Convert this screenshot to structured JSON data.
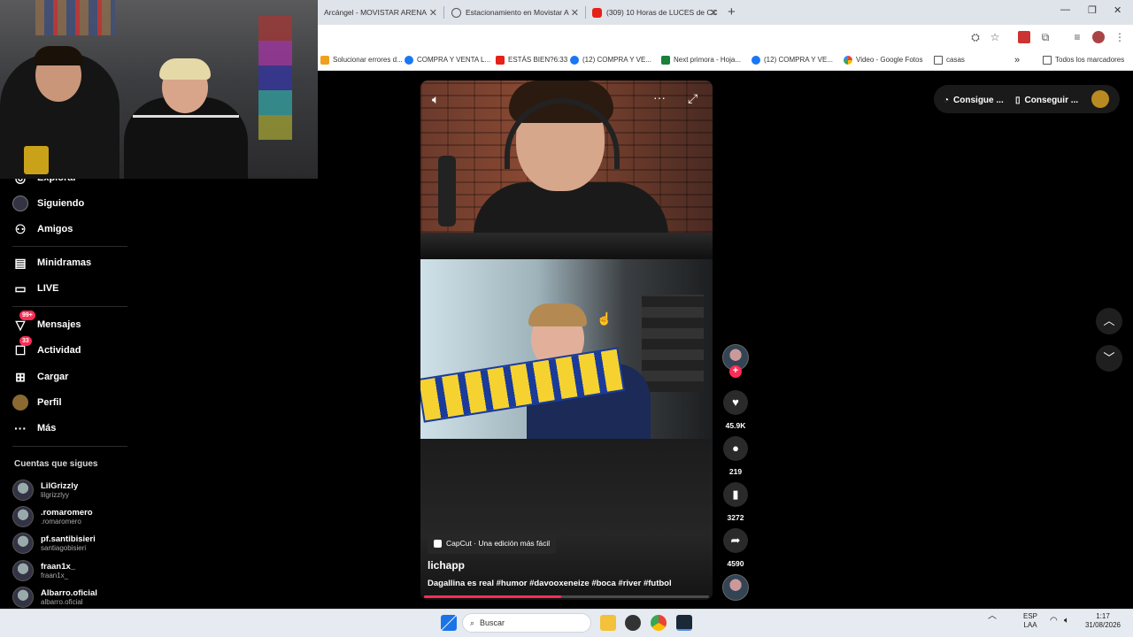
{
  "browser": {
    "tabs": [
      {
        "title": "Arcángel - MOVISTAR ARENA",
        "icon_color": "#dfe3ea"
      },
      {
        "title": "Estacionamiento en Movistar A",
        "icon": "globe-icon"
      },
      {
        "title": "(309) 10 Horas de LUCES de CC",
        "icon": "youtube-icon"
      }
    ],
    "new_tab": "+",
    "window_controls": {
      "minimize": "—",
      "maximize": "❐",
      "close": "✕"
    },
    "bookmarks": [
      {
        "label": "Solucionar errores d...",
        "color": "#f0a020"
      },
      {
        "label": "COMPRA Y VENTA L...",
        "color": "#1877f2"
      },
      {
        "label": "ESTÁS BIEN?6:33",
        "color": "#e62117"
      },
      {
        "label": "(12) COMPRA Y VE...",
        "color": "#1877f2"
      },
      {
        "label": "Next primora - Hoja...",
        "color": "#188038"
      },
      {
        "label": "(12) COMPRA Y VE...",
        "color": "#1877f2"
      },
      {
        "label": "Video - Google Fotos",
        "color": "#fbbc04"
      },
      {
        "label": "casas",
        "color": "#555555"
      }
    ],
    "bookmarks_more": "»",
    "all_bookmarks": "Todos los marcadores"
  },
  "sidebar": {
    "items": [
      {
        "label": "Explorar",
        "icon": "compass-icon"
      },
      {
        "label": "Siguiendo",
        "icon": "following-icon"
      },
      {
        "label": "Amigos",
        "icon": "friends-icon"
      },
      {
        "label": "Minidramas",
        "icon": "minidramas-icon"
      },
      {
        "label": "LIVE",
        "icon": "live-icon"
      },
      {
        "label": "Mensajes",
        "icon": "messages-icon",
        "badge": "99+"
      },
      {
        "label": "Actividad",
        "icon": "activity-icon",
        "badge": "33"
      },
      {
        "label": "Cargar",
        "icon": "upload-icon"
      },
      {
        "label": "Perfil",
        "icon": "profile-icon"
      },
      {
        "label": "Más",
        "icon": "more-icon"
      }
    ],
    "following_title": "Cuentas que sigues",
    "following": [
      {
        "name": "LilGrizzly",
        "handle": "lilgrizzlyy"
      },
      {
        "name": ".romaromero",
        "handle": ".romaromero"
      },
      {
        "name": "pf.santibisieri",
        "handle": "santiagobisieri"
      },
      {
        "name": "fraan1x_",
        "handle": "fraan1x_"
      },
      {
        "name": "Albarro.oficial",
        "handle": "albarro.oficial"
      }
    ]
  },
  "header": {
    "get_coins": "Consigue ...",
    "get_app": "Conseguir ..."
  },
  "video": {
    "capcut_label": "CapCut · Una edición más fácil",
    "author": "lichapp",
    "description": "Dagallina es real #humor #davooxeneize #boca #river #futbol",
    "progress": 0.48,
    "likes": "45.9K",
    "comments": "219",
    "saves": "3272",
    "shares": "4590"
  },
  "taskbar": {
    "search_placeholder": "Buscar",
    "lang_top": "ESP",
    "lang_bottom": "LAA",
    "time": "1:17",
    "date": "31/08/2026"
  },
  "colors": {
    "accent": "#fe2c55",
    "background": "#000000"
  }
}
